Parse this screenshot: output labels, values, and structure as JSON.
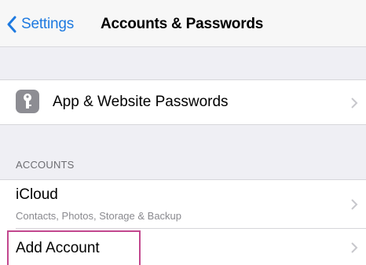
{
  "navbar": {
    "back_label": "Settings",
    "title": "Accounts & Passwords"
  },
  "passwords_row": {
    "icon": "key-icon",
    "label": "App & Website Passwords"
  },
  "accounts_section": {
    "header": "ACCOUNTS",
    "items": [
      {
        "title": "iCloud",
        "subtitle": "Contacts, Photos, Storage & Backup"
      },
      {
        "title": "Add Account"
      }
    ]
  },
  "colors": {
    "accent": "#1e7ae0",
    "background": "#efeff4",
    "highlight": "#c2478e"
  }
}
